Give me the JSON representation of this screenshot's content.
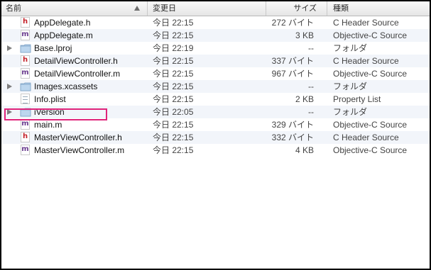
{
  "header": {
    "name": "名前",
    "date": "変更日",
    "size": "サイズ",
    "kind": "種類"
  },
  "files": [
    {
      "name": "AppDelegate.h",
      "date": "今日 22:15",
      "size": "272 バイト",
      "kind": "C Header Source",
      "icon": "header-file-icon",
      "glyph": "h",
      "type": "h",
      "folder": false
    },
    {
      "name": "AppDelegate.m",
      "date": "今日 22:15",
      "size": "3 KB",
      "kind": "Objective-C Source",
      "icon": "objc-source-file-icon",
      "glyph": "m",
      "type": "m",
      "folder": false
    },
    {
      "name": "Base.lproj",
      "date": "今日 22:19",
      "size": "--",
      "kind": "フォルダ",
      "icon": "folder-icon",
      "folder": true
    },
    {
      "name": "DetailViewController.h",
      "date": "今日 22:15",
      "size": "337 バイト",
      "kind": "C Header Source",
      "icon": "header-file-icon",
      "glyph": "h",
      "type": "h",
      "folder": false
    },
    {
      "name": "DetailViewController.m",
      "date": "今日 22:15",
      "size": "967 バイト",
      "kind": "Objective-C Source",
      "icon": "objc-source-file-icon",
      "glyph": "m",
      "type": "m",
      "folder": false
    },
    {
      "name": "Images.xcassets",
      "date": "今日 22:15",
      "size": "--",
      "kind": "フォルダ",
      "icon": "folder-icon",
      "folder": true
    },
    {
      "name": "Info.plist",
      "date": "今日 22:15",
      "size": "2 KB",
      "kind": "Property List",
      "icon": "plist-file-icon",
      "type": "plist",
      "folder": false
    },
    {
      "name": "iVersion",
      "date": "今日 22:05",
      "size": "--",
      "kind": "フォルダ",
      "icon": "folder-icon",
      "folder": true
    },
    {
      "name": "main.m",
      "date": "今日 22:15",
      "size": "329 バイト",
      "kind": "Objective-C Source",
      "icon": "objc-source-file-icon",
      "glyph": "m",
      "type": "m",
      "folder": false
    },
    {
      "name": "MasterViewController.h",
      "date": "今日 22:15",
      "size": "332 バイト",
      "kind": "C Header Source",
      "icon": "header-file-icon",
      "glyph": "h",
      "type": "h",
      "folder": false
    },
    {
      "name": "MasterViewController.m",
      "date": "今日 22:15",
      "size": "4 KB",
      "kind": "Objective-C Source",
      "icon": "objc-source-file-icon",
      "glyph": "m",
      "type": "m",
      "folder": false
    }
  ],
  "colors": {
    "highlight": "#e0237a",
    "folder": "#a9c7e3",
    "header_glyph": "#c4222a",
    "source_glyph": "#6b3d8f"
  }
}
